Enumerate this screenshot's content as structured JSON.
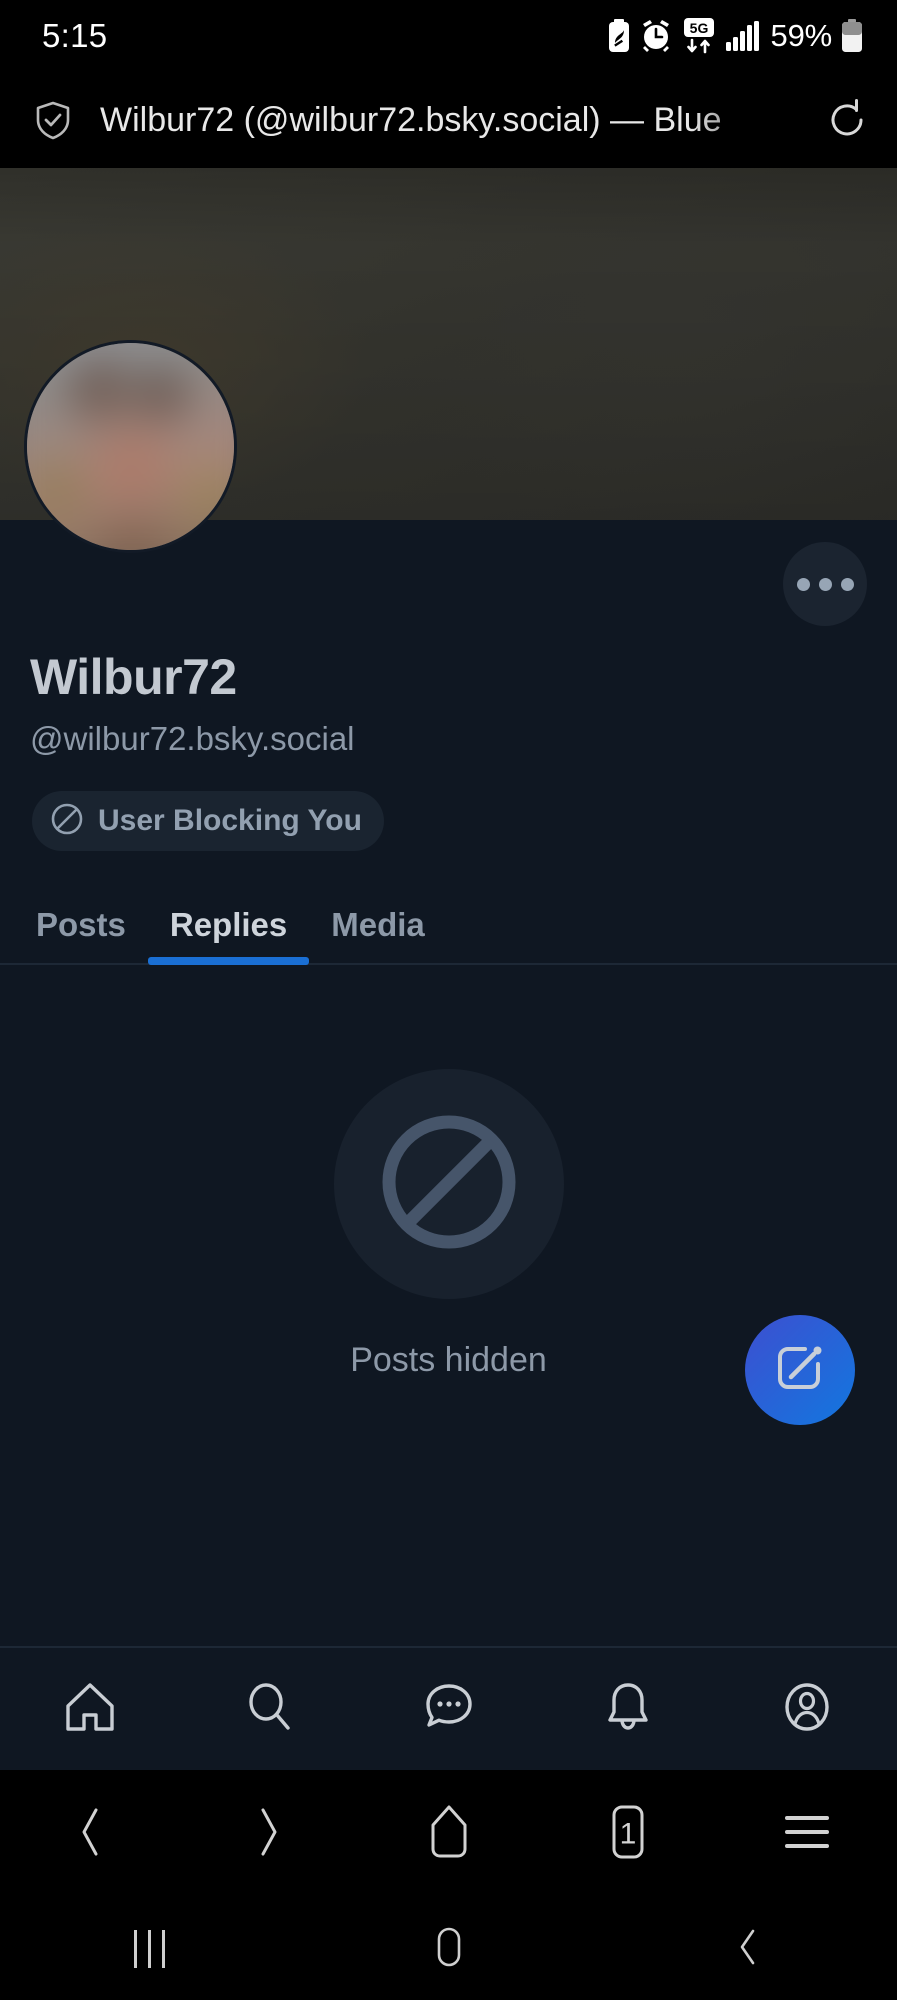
{
  "status_bar": {
    "time": "5:15",
    "battery_percent": "59%",
    "network": "5G",
    "icons": [
      "power-saving-icon",
      "alarm-icon",
      "5g-data-icon",
      "signal-bars-icon",
      "battery-icon"
    ]
  },
  "browser": {
    "title": "Wilbur72 (@wilbur72.bsky.social) — Blue",
    "security_icon": "shield-check-icon",
    "reload_icon": "reload-icon",
    "toolbar": {
      "back_label": "Back",
      "forward_label": "Forward",
      "home_label": "Home",
      "tabs_count": "1",
      "menu_label": "Menu"
    }
  },
  "profile": {
    "display_name": "Wilbur72",
    "handle": "@wilbur72.bsky.social",
    "more_options_label": "More options",
    "block_badge": {
      "label": "User Blocking You",
      "icon": "circle-slash-icon"
    },
    "banner_alt": "profile banner image",
    "avatar_alt": "profile avatar image"
  },
  "tabs": [
    {
      "label": "Posts",
      "active": false
    },
    {
      "label": "Replies",
      "active": true
    },
    {
      "label": "Media",
      "active": false
    }
  ],
  "empty_state": {
    "icon": "circle-slash-icon",
    "label": "Posts hidden"
  },
  "compose": {
    "label": "New post",
    "icon": "compose-icon"
  },
  "app_nav": [
    {
      "name": "home",
      "icon": "home-icon",
      "label": "Home"
    },
    {
      "name": "search",
      "icon": "search-icon",
      "label": "Search"
    },
    {
      "name": "messages",
      "icon": "chat-bubble-icon",
      "label": "Messages"
    },
    {
      "name": "notifications",
      "icon": "bell-icon",
      "label": "Notifications"
    },
    {
      "name": "profile",
      "icon": "person-circle-icon",
      "label": "Profile"
    }
  ],
  "android_nav": [
    {
      "name": "recents",
      "icon": "recents-icon"
    },
    {
      "name": "home",
      "icon": "home-pill-icon"
    },
    {
      "name": "back",
      "icon": "chevron-left-icon"
    }
  ],
  "colors": {
    "accent_blue": "#1a6fd4",
    "fab_gradient_start": "#3d4fd0",
    "fab_gradient_end": "#1277df",
    "page_background": "#0f1722",
    "chrome_background": "#000000"
  }
}
